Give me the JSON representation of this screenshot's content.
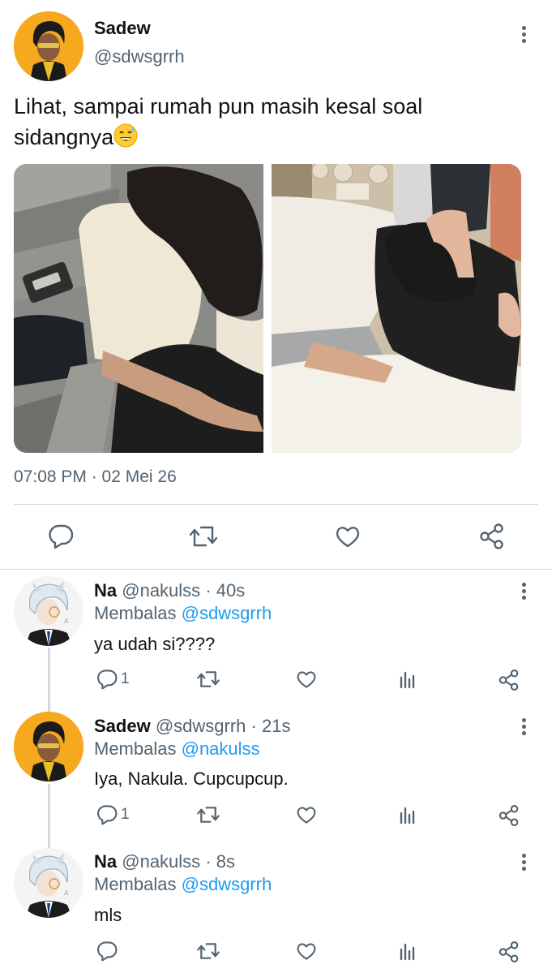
{
  "main_tweet": {
    "author_name": "Sadew",
    "author_handle": "@sdwsgrrh",
    "text": "Lihat, sampai rumah pun masih kesal soal sidangnya",
    "emoji": "sweat-smile-emoji",
    "timestamp": "07:08 PM · 02 Mei 26",
    "actions": [
      "reply-icon",
      "retweet-icon",
      "like-icon",
      "share-icon"
    ]
  },
  "replies": [
    {
      "author_name": "Na",
      "author_handle": "@nakulss",
      "age": "· 40s",
      "replying_label": "Membalas",
      "replying_to": "@sdwsgrrh",
      "text": "ya udah si????",
      "reply_count": "1"
    },
    {
      "author_name": "Sadew",
      "author_handle": "@sdwsgrrh",
      "age": "· 21s",
      "replying_label": "Membalas",
      "replying_to": "@nakulss",
      "text": "Iya, Nakula. Cupcupcup.",
      "reply_count": "1"
    },
    {
      "author_name": "Na",
      "author_handle": "@nakulss",
      "age": "· 8s",
      "replying_label": "Membalas",
      "replying_to": "@sdwsgrrh",
      "text": "mls",
      "reply_count": ""
    }
  ],
  "colors": {
    "text": "#0f1419",
    "secondary": "#536471",
    "link": "#1d9bf0",
    "divider": "#cfd9de",
    "avatar_sadew_bg": "#f5a623"
  }
}
